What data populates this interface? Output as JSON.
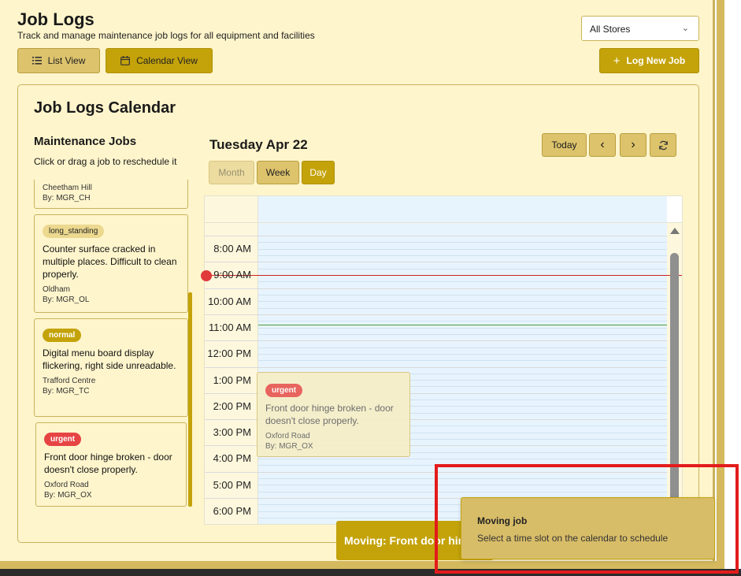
{
  "header": {
    "title": "Job Logs",
    "subtitle": "Track and manage maintenance job logs for all equipment and facilities",
    "store_select": "All Stores",
    "list_view_label": "List View",
    "calendar_view_label": "Calendar View",
    "log_new_job_label": "Log New Job"
  },
  "calendar_card": {
    "title": "Job Logs Calendar"
  },
  "maintenance_jobs": {
    "title": "Maintenance Jobs",
    "hint": "Click or drag a job to reschedule it",
    "items": [
      {
        "badge": "",
        "description": "",
        "location": "Cheetham Hill",
        "by": "By: MGR_CH"
      },
      {
        "badge": "long_standing",
        "description": "Counter surface cracked in multiple places. Difficult to clean properly.",
        "location": "Oldham",
        "by": "By: MGR_OL"
      },
      {
        "badge": "normal",
        "description": "Digital menu board display flickering, right side unreadable.",
        "location": "Trafford Centre",
        "by": "By: MGR_TC"
      },
      {
        "badge": "urgent",
        "description": "Front door hinge broken - door doesn't close properly.",
        "location": "Oxford Road",
        "by": "By: MGR_OX"
      }
    ]
  },
  "calendar": {
    "date_heading": "Tuesday Apr 22",
    "views": {
      "month": "Month",
      "week": "Week",
      "day": "Day"
    },
    "today_label": "Today",
    "prev_label": "‹",
    "next_label": "›",
    "times": [
      "8:00 AM",
      "9:00 AM",
      "10:00 AM",
      "11:00 AM",
      "12:00 PM",
      "1:00 PM",
      "2:00 PM",
      "3:00 PM",
      "4:00 PM",
      "5:00 PM",
      "6:00 PM"
    ],
    "event": {
      "badge": "urgent",
      "description": "Front door hinge broken - door doesn't close properly.",
      "location": "Oxford Road",
      "by": "By: MGR_OX"
    }
  },
  "moving_bar": {
    "text": "Moving: Front door hinge broken - door doesn't close properly."
  },
  "toast": {
    "title": "Moving job",
    "message": "Select a time slot on the calendar to schedule"
  },
  "colors": {
    "accent": "#c4a30a",
    "background": "#fff5cc",
    "urgent": "#e74444",
    "highlight": "#e31b1b"
  }
}
